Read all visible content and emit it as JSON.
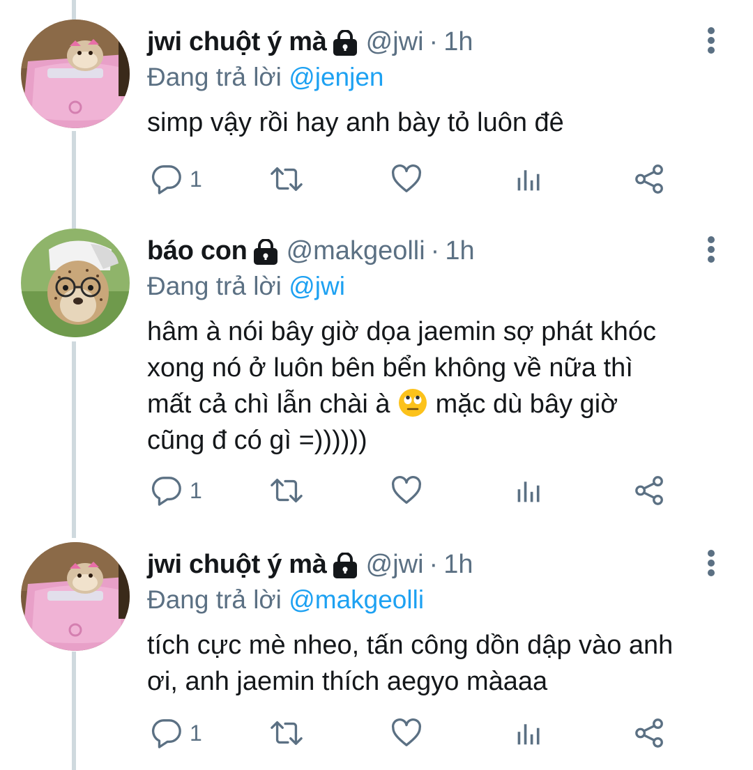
{
  "tweets": [
    {
      "name": "jwi chuột ý mà",
      "handle": "@jwi",
      "dot": "·",
      "time": "1h",
      "reply_prefix": "Đang trả lời",
      "reply_to": "@jenjen",
      "text": "simp vậy rồi hay anh bày tỏ luôn đê",
      "reply_count": "1",
      "avatar": "hamster-in-pink-car"
    },
    {
      "name": "báo con",
      "handle": "@makgeolli",
      "dot": "·",
      "time": "1h",
      "reply_prefix": "Đang trả lời",
      "reply_to": "@jwi",
      "text_part1": "hâm à nói bây giờ dọa jaemin sợ phát khóc\nxong nó ở luôn bên bển không về nữa thì\nmất cả chì lẫn chài à ",
      "emoji": "face-with-rolling-eyes",
      "text_part2": " mặc dù bây giờ\ncũng đ có gì =))))))",
      "reply_count": "1",
      "avatar": "cheetah-cub-with-cap-and-glasses"
    },
    {
      "name": "jwi chuột ý mà",
      "handle": "@jwi",
      "dot": "·",
      "time": "1h",
      "reply_prefix": "Đang trả lời",
      "reply_to": "@makgeolli",
      "text": "tích cực mè nheo, tấn công dồn dập vào anh\nơi, anh jaemin thích aegyo màaaa",
      "reply_count": "1",
      "avatar": "hamster-in-pink-car"
    }
  ],
  "icons": {
    "protected": "lock-icon",
    "more": "more-vertical-icon",
    "reply": "reply-icon",
    "retweet": "retweet-icon",
    "like": "heart-icon",
    "stats": "analytics-icon",
    "share": "share-icon"
  },
  "colors": {
    "text": "#14171a",
    "secondary": "#5b7083",
    "mention": "#1da1f2",
    "thread_line": "#cfd9de"
  }
}
